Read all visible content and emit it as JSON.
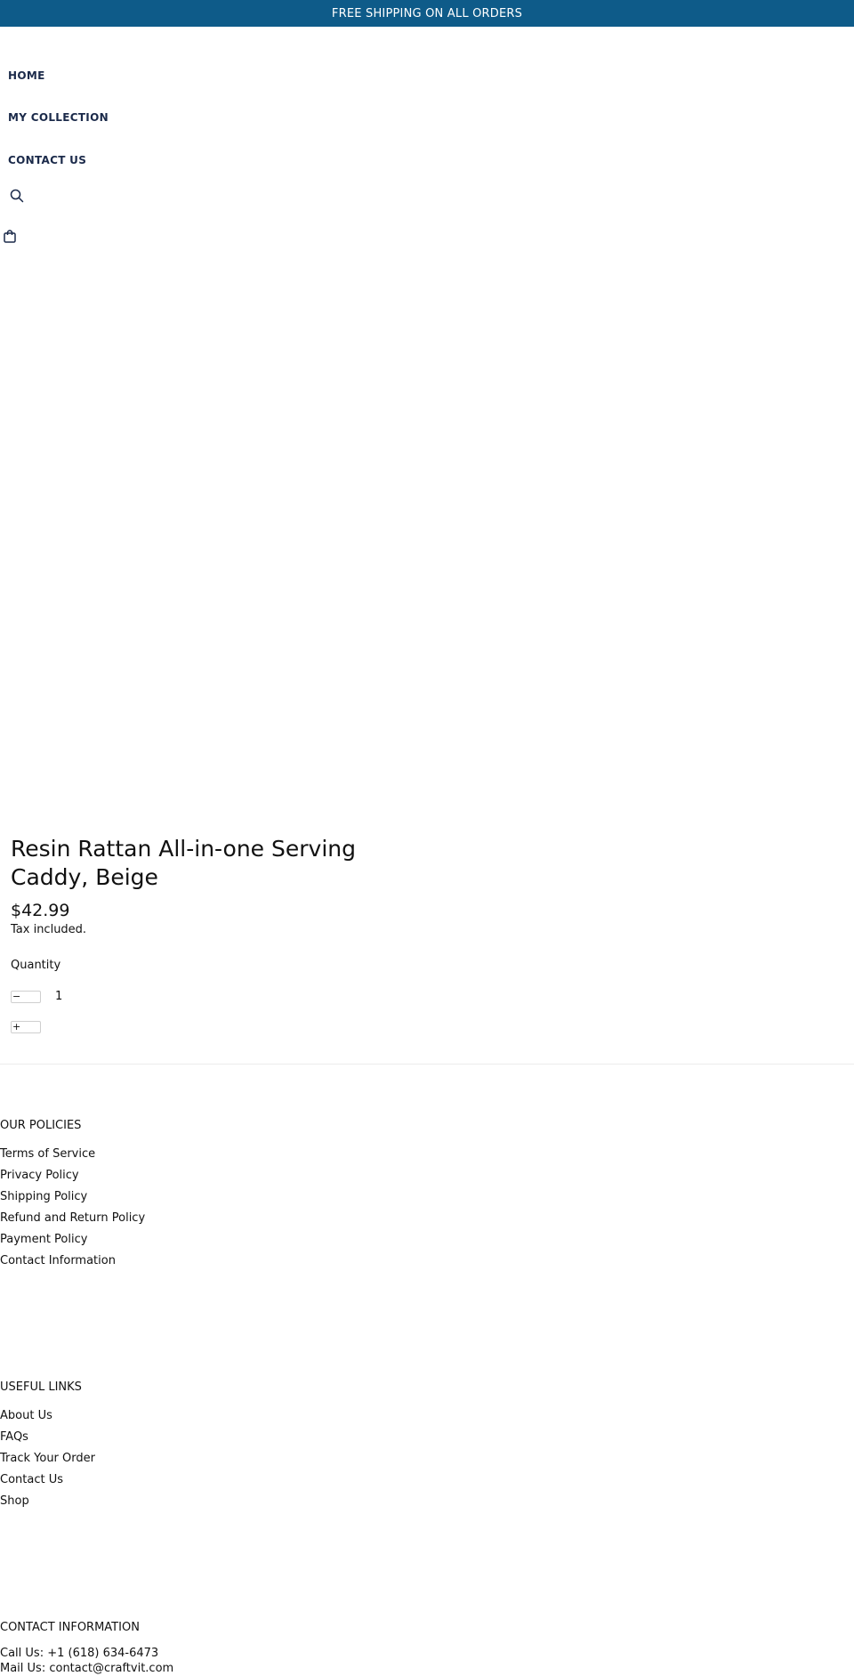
{
  "announcement": {
    "text": "FREE SHIPPING ON ALL ORDERS"
  },
  "nav": {
    "items": [
      {
        "label": "HOME"
      },
      {
        "label": "MY COLLECTION"
      },
      {
        "label": "CONTACT US"
      }
    ],
    "search_icon": "search-icon",
    "cart_icon": "shopping-bag-icon"
  },
  "product": {
    "title": "Resin Rattan All-in-one Serving Caddy, Beige",
    "price": "$42.99",
    "tax_note": "Tax included.",
    "quantity_label": "Quantity",
    "quantity_value": "1",
    "decrease_label": "−",
    "increase_label": "+"
  },
  "footer": {
    "policies": {
      "heading": "OUR POLICIES",
      "links": [
        "Terms of Service",
        "Privacy Policy",
        "Shipping Policy",
        "Refund and Return Policy",
        "Payment Policy",
        "Contact Information"
      ]
    },
    "useful_links": {
      "heading": "USEFUL LINKS",
      "links": [
        "About Us",
        "FAQs",
        "Track Your Order",
        "Contact Us",
        "Shop"
      ]
    },
    "contact": {
      "heading": "CONTACT INFORMATION",
      "phone": "Call Us: +1 (618) 634-6473",
      "email": "Mail Us: contact@craftvit.com"
    }
  },
  "colors": {
    "announcement_bg": "#0e5b89",
    "nav_text": "#1b2a4a"
  }
}
